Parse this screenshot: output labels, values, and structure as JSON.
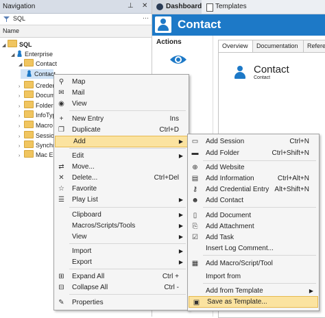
{
  "nav": {
    "title": "Navigation",
    "pin_glyph": "⊥",
    "close_glyph": "✕",
    "search_value": "SQL",
    "more_glyph": "···",
    "column_header": "Name",
    "tree": [
      {
        "label": "SQL",
        "level": 0,
        "icon": "folder-icon",
        "bold": true
      },
      {
        "label": "Enterprise",
        "level": 1,
        "icon": "person-icon"
      },
      {
        "label": "Contact",
        "level": 2,
        "icon": "folder-icon"
      },
      {
        "label": "Contact",
        "level": 3,
        "icon": "person-icon"
      },
      {
        "label": "Credent",
        "level": 2,
        "icon": "folder-icon"
      },
      {
        "label": "Docume",
        "level": 2,
        "icon": "folder-icon"
      },
      {
        "label": "Folders",
        "level": 2,
        "icon": "folder-icon"
      },
      {
        "label": "InfoTyp",
        "level": 2,
        "icon": "folder-icon"
      },
      {
        "label": "Macro",
        "level": 2,
        "icon": "folder-icon"
      },
      {
        "label": "Sessions",
        "level": 2,
        "icon": "folder-icon"
      },
      {
        "label": "Synchro",
        "level": 2,
        "icon": "folder-icon"
      },
      {
        "label": "Mac Ent",
        "level": 2,
        "icon": "folder-icon"
      }
    ]
  },
  "tabs": {
    "dashboard": "Dashboard",
    "templates": "Templates"
  },
  "contact_header": {
    "title": "Contact"
  },
  "actions": {
    "title": "Actions",
    "icon": "eye-icon"
  },
  "right_tabs": [
    "Overview",
    "Documentation",
    "Refere"
  ],
  "entry": {
    "name": "Contact",
    "subtitle": "Contact"
  },
  "context_menu": [
    {
      "label": "Map",
      "icon": "map-pin-icon",
      "glyph": "⚲"
    },
    {
      "label": "Mail",
      "icon": "mail-icon",
      "glyph": "✉"
    },
    {
      "label": "View",
      "icon": "view-icon",
      "glyph": "◉"
    },
    {
      "sep": true
    },
    {
      "label": "New Entry",
      "shortcut": "Ins",
      "icon": "plus-icon",
      "glyph": "+"
    },
    {
      "label": "Duplicate",
      "shortcut": "Ctrl+D",
      "icon": "duplicate-icon",
      "glyph": "❐"
    },
    {
      "label": "Add",
      "submenu": true,
      "highlight": true,
      "icon": "",
      "glyph": ""
    },
    {
      "sep": true
    },
    {
      "label": "Edit",
      "submenu": true,
      "icon": "",
      "glyph": ""
    },
    {
      "label": "Move...",
      "icon": "move-icon",
      "glyph": "⇄"
    },
    {
      "label": "Delete...",
      "shortcut": "Ctrl+Del",
      "icon": "delete-icon",
      "glyph": "✕"
    },
    {
      "label": "Favorite",
      "icon": "star-icon",
      "glyph": "☆"
    },
    {
      "label": "Play List",
      "submenu": true,
      "icon": "playlist-icon",
      "glyph": "☰"
    },
    {
      "sep": true
    },
    {
      "label": "Clipboard",
      "submenu": true,
      "icon": "",
      "glyph": ""
    },
    {
      "label": "Macros/Scripts/Tools",
      "submenu": true,
      "icon": "",
      "glyph": ""
    },
    {
      "label": "View",
      "submenu": true,
      "icon": "",
      "glyph": ""
    },
    {
      "sep": true
    },
    {
      "label": "Import",
      "submenu": true,
      "icon": "",
      "glyph": ""
    },
    {
      "label": "Export",
      "submenu": true,
      "icon": "",
      "glyph": ""
    },
    {
      "sep": true
    },
    {
      "label": "Expand All",
      "shortcut": "Ctrl +",
      "icon": "expand-icon",
      "glyph": "⊞"
    },
    {
      "label": "Collapse All",
      "shortcut": "Ctrl -",
      "icon": "collapse-icon",
      "glyph": "⊟"
    },
    {
      "sep": true
    },
    {
      "label": "Properties",
      "icon": "properties-icon",
      "glyph": "✎"
    }
  ],
  "add_submenu": [
    {
      "label": "Add Session",
      "shortcut": "Ctrl+N",
      "icon": "session-icon",
      "glyph": "▭"
    },
    {
      "label": "Add Folder",
      "shortcut": "Ctrl+Shift+N",
      "icon": "folder-icon",
      "glyph": "▬"
    },
    {
      "sep": true
    },
    {
      "label": "Add Website",
      "icon": "globe-icon",
      "glyph": "⊕"
    },
    {
      "label": "Add Information",
      "shortcut": "Ctrl+Alt+N",
      "icon": "information-icon",
      "glyph": "▤"
    },
    {
      "label": "Add Credential Entry",
      "shortcut": "Alt+Shift+N",
      "icon": "key-icon",
      "glyph": "⚷"
    },
    {
      "label": "Add Contact",
      "icon": "contact-icon",
      "glyph": "☻"
    },
    {
      "sep": true
    },
    {
      "label": "Add Document",
      "icon": "document-icon",
      "glyph": "▯"
    },
    {
      "label": "Add Attachment",
      "icon": "attachment-icon",
      "glyph": "⎘"
    },
    {
      "label": "Add Task",
      "icon": "task-icon",
      "glyph": "☑"
    },
    {
      "label": "Insert Log Comment...",
      "icon": "",
      "glyph": ""
    },
    {
      "sep": true
    },
    {
      "label": "Add Macro/Script/Tool",
      "icon": "macro-icon",
      "glyph": "▦"
    },
    {
      "label": "Import from",
      "icon": "",
      "glyph": ""
    },
    {
      "sep": true
    },
    {
      "label": "Add from Template",
      "submenu": true,
      "icon": "",
      "glyph": ""
    },
    {
      "label": "Save as Template...",
      "highlight": true,
      "icon": "save-template-icon",
      "glyph": "▣"
    }
  ],
  "colors": {
    "accent": "#1d79c7",
    "highlight": "#fbe3a0",
    "folder": "#f0c560"
  }
}
